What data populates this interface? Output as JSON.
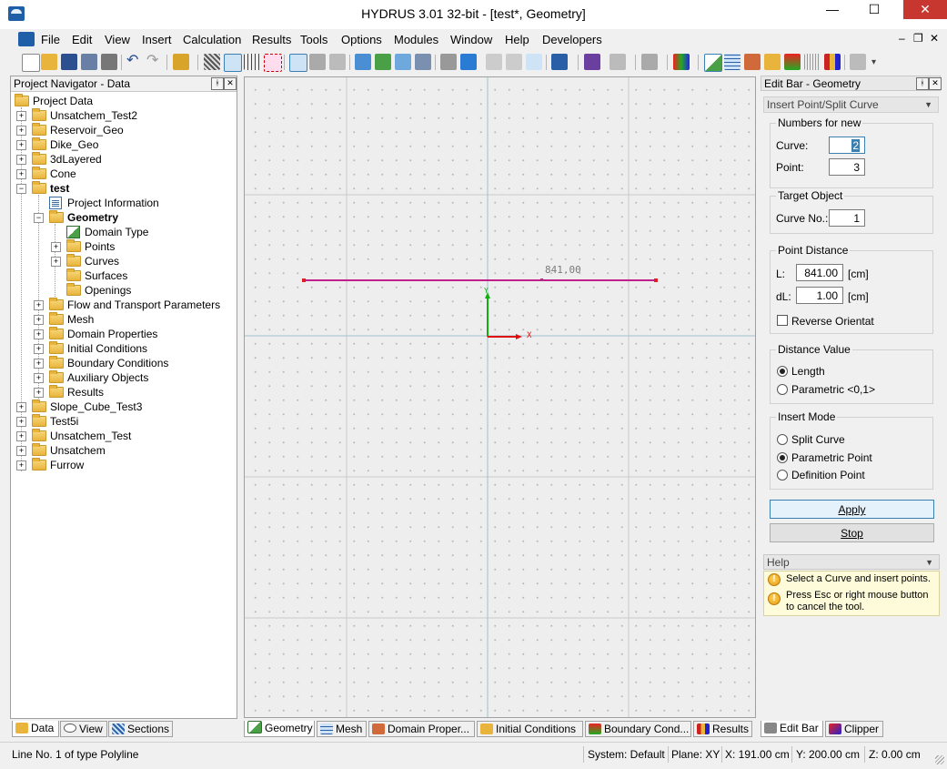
{
  "window": {
    "title": "HYDRUS 3.01 32-bit - [test*, Geometry]",
    "min": "—",
    "max": "☐",
    "close": "✕"
  },
  "menu": [
    "File",
    "Edit",
    "View",
    "Insert",
    "Calculation",
    "Results",
    "Tools",
    "Options",
    "Modules",
    "Window",
    "Help",
    "Developers"
  ],
  "mdi": {
    "min": "–",
    "restore": "❐",
    "close": "✕"
  },
  "navigator": {
    "title": "Project Navigator - Data",
    "pin": "ᚼ",
    "close": "✕",
    "root": "Project Data",
    "projects_top": [
      "Unsatchem_Test2",
      "Reservoir_Geo",
      "Dike_Geo",
      "3dLayered",
      "Cone"
    ],
    "current": "test",
    "current_children": {
      "info": "Project Information",
      "geometry": "Geometry",
      "geometry_children": [
        "Domain Type",
        "Points",
        "Curves",
        "Surfaces",
        "Openings"
      ],
      "rest": [
        "Flow and Transport Parameters",
        "Mesh",
        "Domain Properties",
        "Initial Conditions",
        "Boundary Conditions",
        "Auxiliary Objects",
        "Results"
      ]
    },
    "projects_bottom": [
      "Slope_Cube_Test3",
      "Test5i",
      "Unsatchem_Test",
      "Unsatchem",
      "Furrow"
    ],
    "tabs": [
      "Data",
      "View",
      "Sections"
    ]
  },
  "canvas": {
    "length_label": "841.00",
    "axis_x": "X",
    "axis_y": "Y",
    "tabs": [
      "Geometry",
      "Mesh",
      "Domain Proper...",
      "Initial Conditions",
      "Boundary Cond...",
      "Results"
    ]
  },
  "editbar": {
    "title": "Edit Bar - Geometry",
    "tool": "Insert Point/Split Curve",
    "numbers": {
      "title": "Numbers for new",
      "curve_label": "Curve:",
      "curve_value": "2",
      "point_label": "Point:",
      "point_value": "3"
    },
    "target": {
      "title": "Target Object",
      "curve_label": "Curve No.:",
      "curve_value": "1"
    },
    "distance": {
      "title": "Point Distance",
      "l_label": "L:",
      "l_value": "841.00",
      "l_unit": "[cm]",
      "dl_label": "dL:",
      "dl_value": "1.00",
      "dl_unit": "[cm]",
      "reverse": "Reverse Orientat"
    },
    "dvalue": {
      "title": "Distance Value",
      "length": "Length",
      "parametric": "Parametric <0,1>"
    },
    "mode": {
      "title": "Insert Mode",
      "split": "Split Curve",
      "parametric": "Parametric Point",
      "definition": "Definition Point"
    },
    "apply": "Apply",
    "stop": "Stop",
    "tabs": [
      "Edit Bar",
      "Clipper"
    ]
  },
  "help": {
    "title": "Help",
    "lines": [
      "Select a Curve and insert points.",
      "Press Esc or right mouse button to cancel the tool."
    ]
  },
  "status": {
    "message": "Line No. 1 of type Polyline",
    "system": "System: Default",
    "plane": "Plane: XY",
    "x": "X:  191.00 cm",
    "y": "Y:  200.00 cm",
    "z": "Z:  0.00 cm"
  },
  "colors": {
    "curve": "#c0208a",
    "axis_x": "#e01010",
    "axis_y": "#10b010",
    "title_close": "#c7372f"
  }
}
